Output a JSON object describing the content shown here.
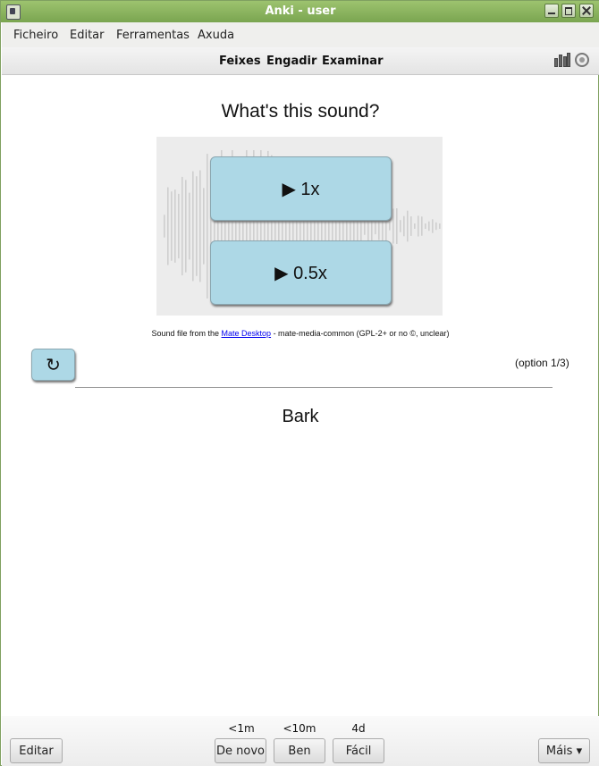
{
  "window": {
    "title": "Anki - user"
  },
  "menu": {
    "items": [
      "Ficheiro",
      "Editar",
      "Ferramentas",
      "Axuda"
    ]
  },
  "toolbar": {
    "items": [
      "Feixes",
      "Engadir",
      "Examinar"
    ],
    "icons": [
      "stats-icon",
      "sync-icon"
    ]
  },
  "card": {
    "question": "What's this sound?",
    "play_buttons": [
      "▶ 1x",
      "▶ 0.5x"
    ],
    "credit_prefix": "Sound file from the ",
    "credit_link": "Mate Desktop",
    "credit_suffix": " - mate-media-common (GPL-2+ or no ©, unclear)",
    "cycle_symbol": "↻",
    "option_label": "(option 1/3)",
    "answer": "Bark"
  },
  "bottom": {
    "edit_label": "Editar",
    "more_label": "Máis ▾",
    "intervals": [
      "<1m",
      "<10m",
      "4d"
    ],
    "answer_buttons": [
      "De novo",
      "Ben",
      "Fácil"
    ]
  },
  "colors": {
    "titlebar": "#8ab45e",
    "button_blue": "#add8e6",
    "waveform_bg": "#ececec"
  }
}
